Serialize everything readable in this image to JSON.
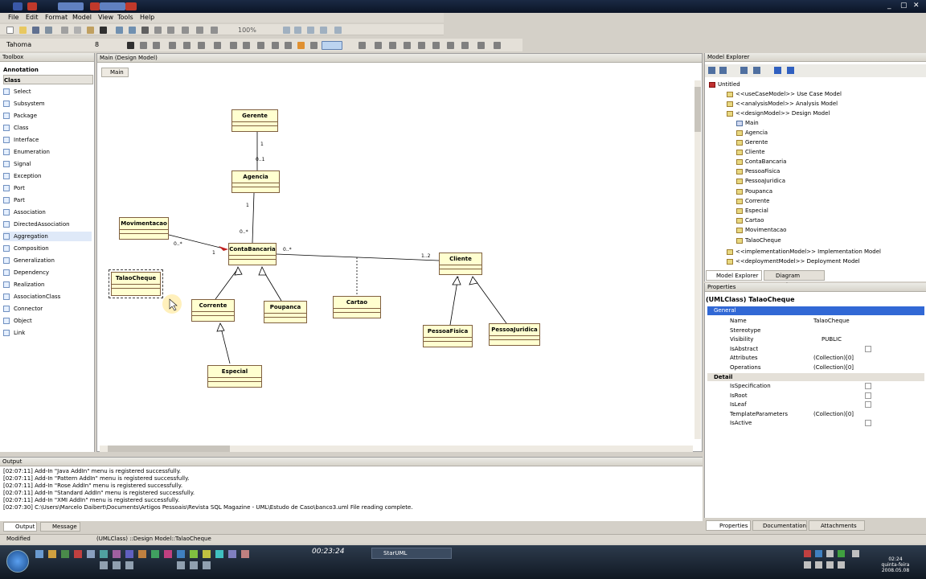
{
  "window": {
    "title": "StarUML"
  },
  "menu": [
    "File",
    "Edit",
    "Format",
    "Model",
    "View",
    "Tools",
    "Help"
  ],
  "toolbar": {
    "zoom": "100%",
    "font_name": "Tahoma",
    "font_size": "8"
  },
  "toolbox": {
    "title": "Toolbox",
    "sections": [
      "Annotation",
      "Class"
    ],
    "items": [
      "Select",
      "Subsystem",
      "Package",
      "Class",
      "Interface",
      "Enumeration",
      "Signal",
      "Exception",
      "Port",
      "Part",
      "Association",
      "DirectedAssociation",
      "Aggregation",
      "Composition",
      "Generalization",
      "Dependency",
      "Realization",
      "AssociationClass",
      "Connector",
      "Object",
      "Link"
    ]
  },
  "diagram": {
    "panel_title": "Main (Design Model)",
    "tab": "Main",
    "classes": [
      "Gerente",
      "Agencia",
      "Movimentacao",
      "ContaBancaria",
      "TalaoCheque",
      "Corrente",
      "Poupanca",
      "Cartao",
      "Cliente",
      "PessoaFisica",
      "PessoaJuridica",
      "Especial"
    ],
    "multiplicities": [
      "1",
      "0..1",
      "1",
      "0..*",
      "0..*",
      "1",
      "0..*",
      "1..2"
    ]
  },
  "explorer": {
    "title": "Model Explorer",
    "root": "Untitled",
    "items": [
      "<<useCaseModel>> Use Case Model",
      "<<analysisModel>> Analysis Model",
      "<<designModel>> Design Model",
      "Main",
      "Agencia",
      "Gerente",
      "Cliente",
      "ContaBancaria",
      "PessoaFisica",
      "PessoaJuridica",
      "Poupanca",
      "Corrente",
      "Especial",
      "Cartao",
      "Movimentacao",
      "TalaoCheque",
      "<<implementationModel>> Implementation Model",
      "<<deploymentModel>> Deployment Model"
    ],
    "tabs": [
      "Model Explorer",
      "Diagram Explorer"
    ]
  },
  "properties": {
    "title": "Properties",
    "header": "(UMLClass) TalaoCheque",
    "groups": [
      "General",
      "Detail"
    ],
    "general": [
      {
        "name": "Name",
        "value": "TalaoCheque"
      },
      {
        "name": "Stereotype",
        "value": ""
      },
      {
        "name": "Visibility",
        "value": "PUBLIC"
      },
      {
        "name": "IsAbstract",
        "value": ""
      },
      {
        "name": "Attributes",
        "value": "(Collection)[0]"
      },
      {
        "name": "Operations",
        "value": "(Collection)[0]"
      }
    ],
    "detail": [
      {
        "name": "IsSpecification",
        "value": ""
      },
      {
        "name": "IsRoot",
        "value": ""
      },
      {
        "name": "IsLeaf",
        "value": ""
      },
      {
        "name": "TemplateParameters",
        "value": "(Collection)[0]"
      },
      {
        "name": "IsActive",
        "value": ""
      }
    ],
    "tabs": [
      "Properties",
      "Documentation",
      "Attachments"
    ]
  },
  "output": {
    "title": "Output",
    "lines": [
      "[02:07:11]  Add-In \"Java AddIn\" menu is registered successfully.",
      "[02:07:11]  Add-In \"Pattern AddIn\" menu is registered successfully.",
      "[02:07:11]  Add-In \"Rose AddIn\" menu is registered successfully.",
      "[02:07:11]  Add-In \"Standard AddIn\" menu is registered successfully.",
      "[02:07:11]  Add-In \"XMI AddIn\" menu is registered successfully.",
      "[02:07:30]  C:\\Users\\Marcelo Daibert\\Documents\\Artigos Pessoais\\Revista SQL Magazine - UML\\Estudo de Caso\\banco3.uml File reading complete."
    ],
    "tabs": [
      "Output",
      "Message"
    ]
  },
  "status": {
    "mode": "Modified",
    "selection": "(UMLClass) ::Design Model::TalaoCheque"
  },
  "taskbar": {
    "app": "StarUML",
    "time": "00:23:24",
    "clock_day": "quinta-feira",
    "clock_date": "2008.05.08",
    "clock_time": "02:24"
  }
}
